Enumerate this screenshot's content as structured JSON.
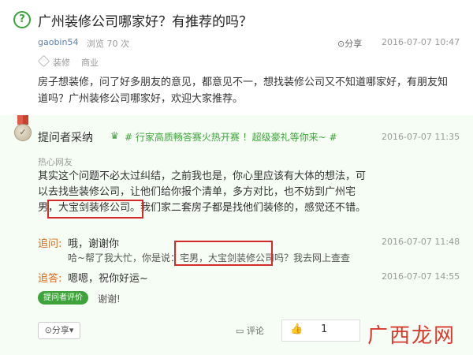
{
  "question": {
    "icon": "question-circle-icon",
    "title": "广州装修公司哪家好？有推荐的吗？",
    "user": "gaobin54",
    "views": "浏览 70 次",
    "share": "分享",
    "date": "2016-07-07 10:47",
    "tags": [
      "装修",
      "商业"
    ],
    "body": "房子想装修，问了好多朋友的意见，都意见不一，想找装修公司又不知道哪家好，有朋友知道吗？广州装修公司哪家好，欢迎大家推荐。"
  },
  "accepted": {
    "label": "提问者采纳",
    "promo": "# 行家高质畅答赛火热开赛 ！超级豪礼等你来~ #",
    "date": "2016-07-07 11:35",
    "user": "热心网友",
    "answer": "其实这个问题不必太过纠结，之前我也是，你心里应该有大体的想法，可以去找些装修公司，让他们给你报个清单，多方对比，也不妨到广州宅男，大宝剑装修公司。我们家二套房子都是找他们装修的，感觉还不错。"
  },
  "followups": {
    "q_label": "追问",
    "q_text": "哦，谢谢你",
    "q_date": "2016-07-07 11:48",
    "reply": "哈~帮了我大忙，你是说：宅男，大宝剑装修公司吗？我去网上查查",
    "a_label": "追答",
    "a_text": "嗯嗯，祝你好运~",
    "a_date": "2016-07-07 14:55"
  },
  "rating": {
    "button": "提问者评价",
    "text": "谢谢!"
  },
  "actions": {
    "share": "分享",
    "comment": "评论",
    "likes": "1"
  },
  "watermark": "广西龙网",
  "colors": {
    "accent": "#3da33a",
    "highlight": "#d42a2a",
    "followup": "#d96a1a"
  }
}
